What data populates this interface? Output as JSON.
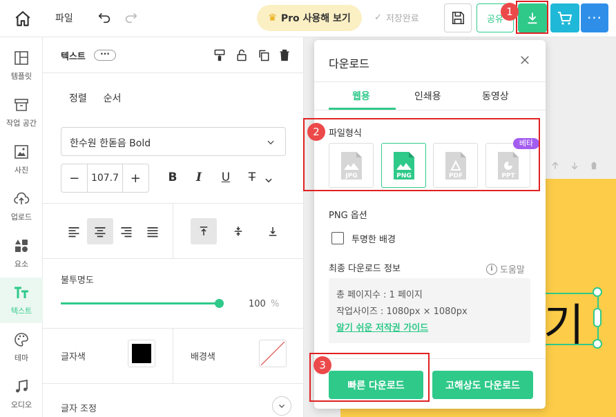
{
  "topbar": {
    "file_label": "파일",
    "pro_label": "Pro 사용해 보기",
    "saved_label": "저장완료",
    "share_label": "공유",
    "more_label": "···",
    "colors": {
      "pro_bg": "#fbefc4",
      "green": "#2fc98a",
      "cyan": "#20b8d8",
      "blue": "#2f8fe8"
    }
  },
  "sidebar": {
    "items": [
      {
        "label": "템플릿",
        "icon": "template-icon"
      },
      {
        "label": "작업 공간",
        "icon": "workspace-icon"
      },
      {
        "label": "사진",
        "icon": "photo-icon"
      },
      {
        "label": "업로드",
        "icon": "upload-icon"
      },
      {
        "label": "요소",
        "icon": "elements-icon"
      },
      {
        "label": "텍스트",
        "icon": "text-icon",
        "active": true
      },
      {
        "label": "테마",
        "icon": "palette-icon"
      },
      {
        "label": "오디오",
        "icon": "music-icon"
      }
    ]
  },
  "panel": {
    "title": "텍스트",
    "dots": "···",
    "tabs": [
      "정렬",
      "순서"
    ],
    "font_family": "한수원 한돋음 Bold",
    "font_size": "107.7",
    "opacity_label": "불투명도",
    "opacity_value": "100",
    "opacity_unit": "%",
    "opacity_level": 1.0,
    "text_color_label": "글자색",
    "text_color": "#000000",
    "bg_color_label": "배경색",
    "adjust_label": "글자 조정"
  },
  "canvas": {
    "text_glyph": "기",
    "artboard_color": "#fdcc49"
  },
  "dialog": {
    "title": "다운로드",
    "tabs": [
      "웹용",
      "인쇄용",
      "동영상"
    ],
    "active_tab": "웹용",
    "format_label": "파일형식",
    "formats": [
      "JPG",
      "PNG",
      "PDF",
      "PPT"
    ],
    "selected_format": "PNG",
    "beta_label": "베타",
    "png_options_label": "PNG 옵션",
    "transparent_label": "투명한 배경",
    "transparent_checked": false,
    "info_label": "최종 다운로드 정보",
    "help_label": "도움말",
    "total_pages": "총 페이지수 : 1 페이지",
    "work_size": "작업사이즈 : 1080px × 1080px",
    "guide_link": "알기 쉬운 저작권 가이드",
    "quick_download": "빠른 다운로드",
    "hq_download": "고해상도 다운로드"
  },
  "annotations": {
    "badges": [
      "1",
      "2",
      "3"
    ],
    "color": "#e02020"
  }
}
